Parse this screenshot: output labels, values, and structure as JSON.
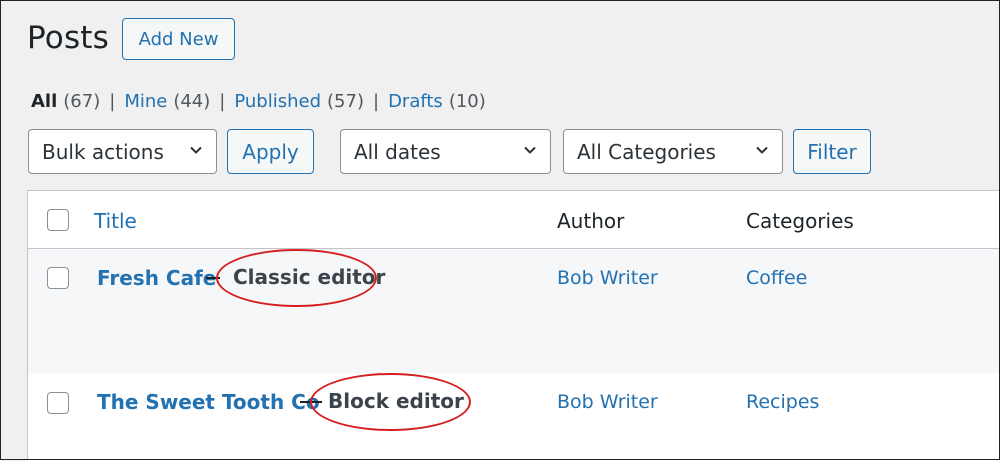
{
  "header": {
    "title": "Posts",
    "add_new_label": "Add New"
  },
  "views": [
    {
      "label": "All",
      "count": "(67)",
      "current": true
    },
    {
      "label": "Mine",
      "count": "(44)"
    },
    {
      "label": "Published",
      "count": "(57)"
    },
    {
      "label": "Drafts",
      "count": "(10)"
    }
  ],
  "views_separator": "|",
  "filters": {
    "bulk_actions": "Bulk actions",
    "apply_label": "Apply",
    "dates": "All dates",
    "categories": "All Categories",
    "filter_label": "Filter"
  },
  "table": {
    "columns": {
      "title": "Title",
      "author": "Author",
      "categories": "Categories"
    },
    "rows": [
      {
        "title": "Fresh Cafe",
        "author": "Bob Writer",
        "category": "Coffee",
        "annotation": "Classic editor"
      },
      {
        "title": "The Sweet Tooth Co",
        "author": "Bob Writer",
        "category": "Recipes",
        "annotation": "Block editor"
      }
    ]
  },
  "colors": {
    "accent": "#2271b1",
    "annotation_circle": "#d51f1f",
    "background": "#f0f0f1"
  },
  "icons": {
    "dropdown": "chevron-down-icon",
    "checkbox": "checkbox-icon"
  }
}
